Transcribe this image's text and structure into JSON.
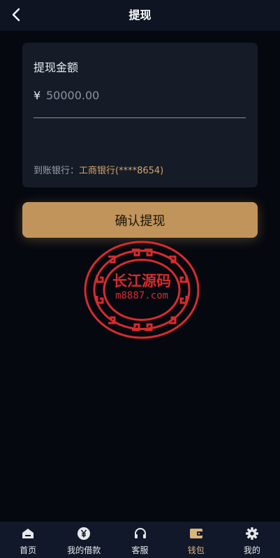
{
  "header": {
    "title": "提现"
  },
  "card": {
    "title": "提现金额",
    "currency_symbol": "¥",
    "amount_placeholder": "50000.00",
    "bank_label": "到账银行：",
    "bank_value": "工商银行(****8654)"
  },
  "confirm_button": {
    "label": "确认提现"
  },
  "watermark": {
    "line1": "长江源码",
    "line2": "m8887.com"
  },
  "bottom_nav": {
    "items": [
      {
        "label": "首页",
        "icon": "home-icon"
      },
      {
        "label": "我的借款",
        "icon": "yen-icon"
      },
      {
        "label": "客服",
        "icon": "headset-icon"
      },
      {
        "label": "钱包",
        "icon": "wallet-icon"
      },
      {
        "label": "我的",
        "icon": "gear-icon"
      }
    ],
    "active_index": 3
  },
  "colors": {
    "background": "#05080f",
    "card": "#151b27",
    "accent": "#c1945c",
    "nav_active": "#d9b57e",
    "bank_value": "#d4a46a",
    "watermark_red": "#d92b2b"
  }
}
